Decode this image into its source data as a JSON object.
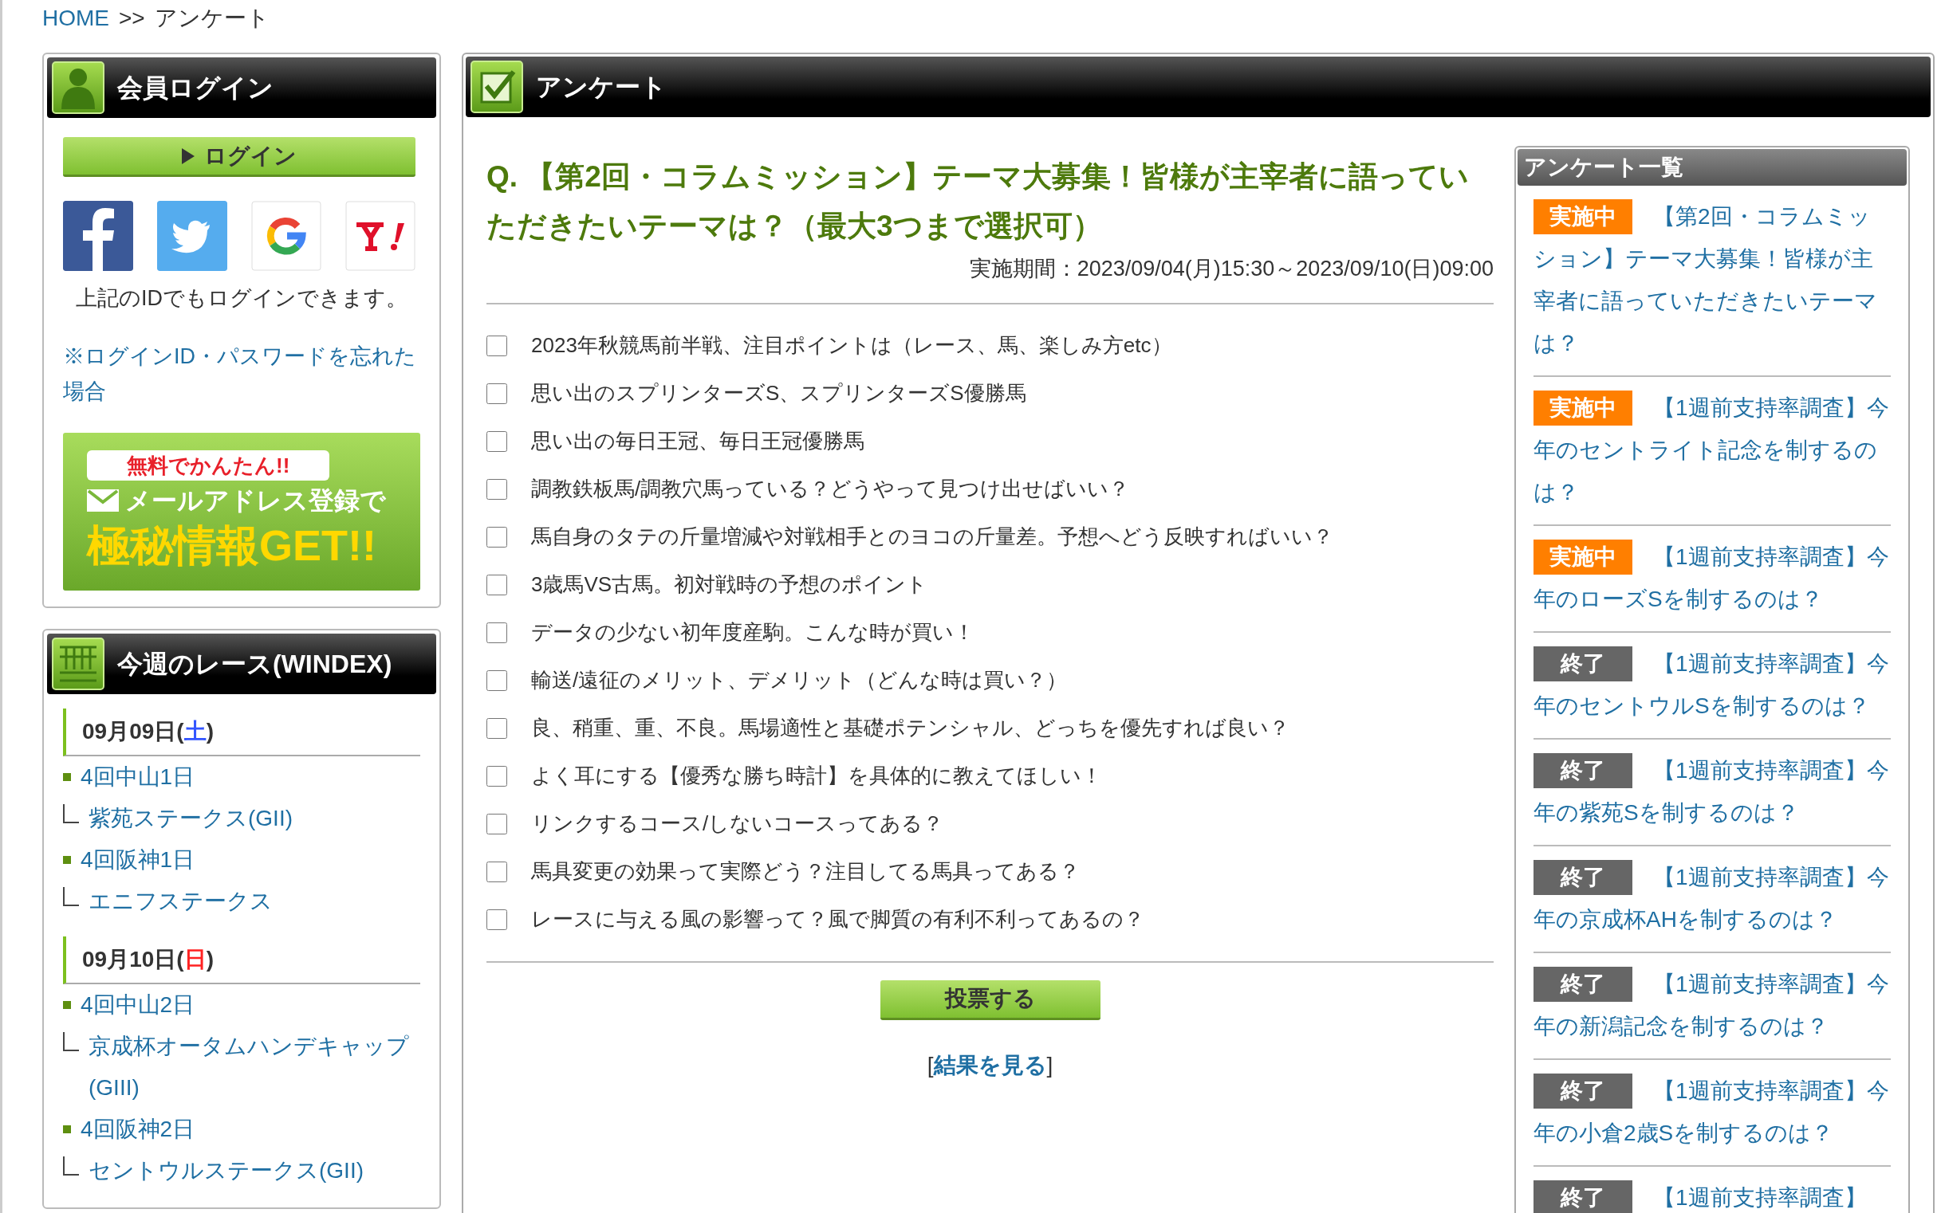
{
  "breadcrumb": {
    "home": "HOME",
    "separator": ">>",
    "current": "アンケート"
  },
  "login_box": {
    "title": "会員ログイン",
    "button": "ログイン",
    "note": "上記のIDでもログインできます。",
    "forgot_link": "※ログインID・パスワードを忘れた場合",
    "banner": {
      "bubble": "無料でかんたん!!",
      "line1": "メールアドレス登録で",
      "line2": "極秘情報GET!!"
    }
  },
  "races_box": {
    "title": "今週のレース(WINDEX)",
    "days": [
      {
        "date": "09月09日(",
        "weekday": "土",
        "date_end": ")",
        "color": "#3355ff",
        "meetings": [
          {
            "name": "4回中山1日",
            "race": "紫苑ステークス(GII)"
          },
          {
            "name": "4回阪神1日",
            "race": "エニフステークス"
          }
        ]
      },
      {
        "date": "09月10日(",
        "weekday": "日",
        "date_end": ")",
        "color": "#ff2222",
        "meetings": [
          {
            "name": "4回中山2日",
            "race": "京成杯オータムハンデキャップ(GIII)"
          },
          {
            "name": "4回阪神2日",
            "race": "セントウルステークス(GII)"
          }
        ]
      }
    ]
  },
  "survey": {
    "title": "アンケート",
    "question": "Q. 【第2回・コラムミッション】テーマ大募集！皆様が主宰者に語っていただきたいテーマは？（最大3つまで選択可）",
    "period": "実施期間：2023/09/04(月)15:30～2023/09/10(日)09:00",
    "options": [
      {
        "label": "2023年秋競馬前半戦、注目ポイントは（レース、馬、楽しみ方etc）",
        "checked": false
      },
      {
        "label": "思い出のスプリンターズS、スプリンターズS優勝馬",
        "checked": false
      },
      {
        "label": "思い出の毎日王冠、毎日王冠優勝馬",
        "checked": false
      },
      {
        "label": "調教鉄板馬/調教穴馬っている？どうやって見つけ出せばいい？",
        "checked": false
      },
      {
        "label": "馬自身のタテの斤量増減や対戦相手とのヨコの斤量差。予想へどう反映すればいい？",
        "checked": false
      },
      {
        "label": "3歳馬VS古馬。初対戦時の予想のポイント",
        "checked": false
      },
      {
        "label": "データの少ない初年度産駒。こんな時が買い！",
        "checked": false
      },
      {
        "label": "輸送/遠征のメリット、デメリット（どんな時は買い？）",
        "checked": false
      },
      {
        "label": "良、稍重、重、不良。馬場適性と基礎ポテンシャル、どっちを優先すれば良い？",
        "checked": false
      },
      {
        "label": "よく耳にする【優秀な勝ち時計】を具体的に教えてほしい！",
        "checked": false
      },
      {
        "label": "リンクするコース/しないコースってある？",
        "checked": false
      },
      {
        "label": "馬具変更の効果って実際どう？注目してる馬具ってある？",
        "checked": false
      },
      {
        "label": "レースに与える風の影響って？風で脚質の有利不利ってあるの？",
        "checked": false
      }
    ],
    "vote_button": "投票する",
    "results_open": "[",
    "results_link": "結果を見る",
    "results_close": "]"
  },
  "survey_list": {
    "title": "アンケート一覧",
    "items": [
      {
        "status": "実施中",
        "color": "#ff7f00",
        "title": "【第2回・コラムミッション】テーマ大募集！皆様が主宰者に語っていただきたいテーマは？"
      },
      {
        "status": "実施中",
        "color": "#ff7f00",
        "title": "【1週前支持率調査】今年のセントライト記念を制するのは？"
      },
      {
        "status": "実施中",
        "color": "#ff7f00",
        "title": "【1週前支持率調査】今年のローズSを制するのは？"
      },
      {
        "status": "終了",
        "color": "#666666",
        "title": "【1週前支持率調査】今年のセントウルSを制するのは？"
      },
      {
        "status": "終了",
        "color": "#666666",
        "title": "【1週前支持率調査】今年の紫苑Sを制するのは？"
      },
      {
        "status": "終了",
        "color": "#666666",
        "title": "【1週前支持率調査】今年の京成杯AHを制するのは？"
      },
      {
        "status": "終了",
        "color": "#666666",
        "title": "【1週前支持率調査】今年の新潟記念を制するのは？"
      },
      {
        "status": "終了",
        "color": "#666666",
        "title": "【1週前支持率調査】今年の小倉2歳Sを制するのは？"
      },
      {
        "status": "終了",
        "color": "#666666",
        "title": "【1週前支持率調査】"
      }
    ]
  }
}
